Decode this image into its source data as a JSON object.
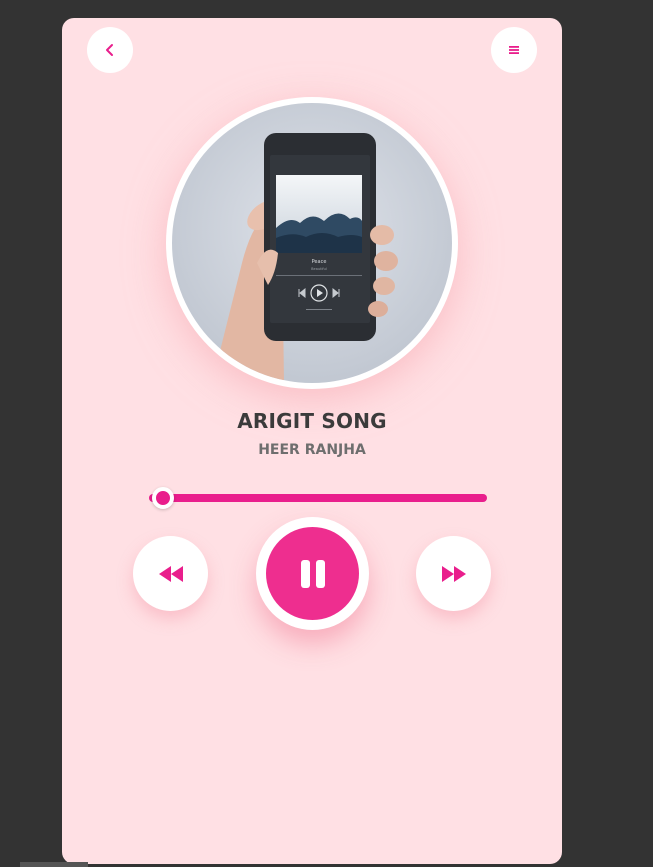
{
  "player": {
    "song_title": "ARIGIT SONG",
    "artist": "HEER RANJHA",
    "progress": 0.04,
    "is_playing": true
  },
  "icons": {
    "back": "chevron-left-icon",
    "menu": "hamburger-menu-icon",
    "rewind": "rewind-icon",
    "pause": "pause-icon",
    "forward": "fast-forward-icon"
  },
  "colors": {
    "accent": "#e91e8c",
    "card_background": "#ffe0e4",
    "page_background": "#333333",
    "title_text": "#3b3b3b",
    "artist_text": "#6e6e6e"
  },
  "album_art": {
    "phone_screen": {
      "track_name": "Peace",
      "artist_name": "Beautiful"
    }
  }
}
